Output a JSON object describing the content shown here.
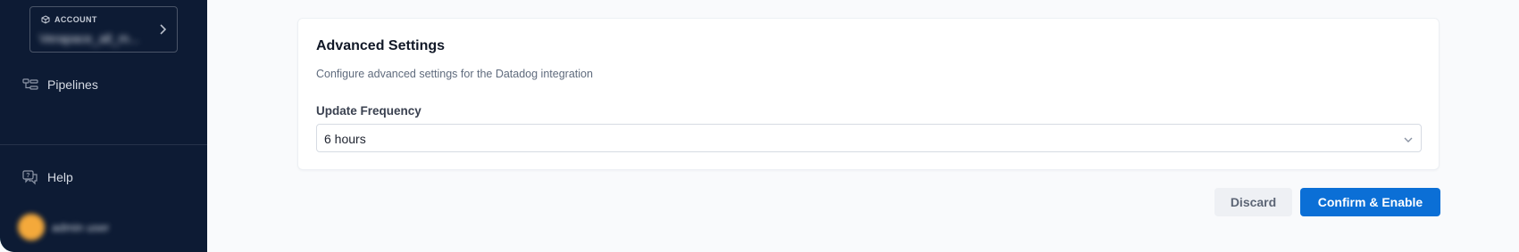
{
  "sidebar": {
    "account": {
      "label": "ACCOUNT",
      "name": "Verapace_all_m..."
    },
    "nav": {
      "pipelines": "Pipelines",
      "help": "Help"
    },
    "user": {
      "name": "admin user"
    }
  },
  "settings": {
    "title": "Advanced Settings",
    "subtitle": "Configure advanced settings for the Datadog integration",
    "update_frequency": {
      "label": "Update Frequency",
      "value": "6 hours"
    }
  },
  "actions": {
    "discard": "Discard",
    "confirm": "Confirm & Enable"
  },
  "colors": {
    "sidebar_bg": "#0d1b34",
    "primary": "#0b6fd6",
    "page_bg": "#f9fafc"
  }
}
